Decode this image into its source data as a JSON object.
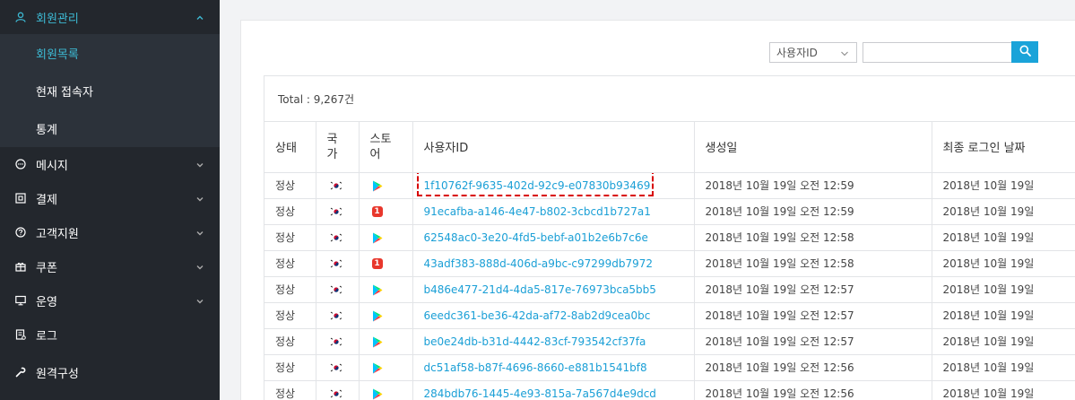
{
  "sidebar": {
    "member_menu": {
      "label": "회원관리",
      "icon": "user-icon"
    },
    "sub_items": [
      "회원목록",
      "현재 접속자",
      "통계"
    ],
    "items": [
      {
        "label": "메시지",
        "icon": "chat-icon"
      },
      {
        "label": "결제",
        "icon": "payment-icon"
      },
      {
        "label": "고객지원",
        "icon": "help-icon"
      },
      {
        "label": "쿠폰",
        "icon": "gift-icon"
      },
      {
        "label": "운영",
        "icon": "monitor-icon"
      },
      {
        "label": "로그",
        "icon": "log-icon"
      },
      {
        "label": "원격구성",
        "icon": "wrench-icon"
      }
    ],
    "accent": "#3db9d3"
  },
  "search": {
    "select_value": "사용자ID",
    "input_value": "",
    "button_icon": "search-icon"
  },
  "table": {
    "total": "Total : 9,267건",
    "headers": {
      "status": "상태",
      "country": "국가",
      "store": "스토어",
      "user_id": "사용자ID",
      "created": "생성일",
      "last_login": "최종 로그인 날짜"
    },
    "rows": [
      {
        "status": "정상",
        "country": "kr-flag-icon",
        "store": "google-play-icon",
        "user_id": "1f10762f-9635-402d-92c9-e07830b93469",
        "created": "2018년 10월 19일 오전 12:59",
        "last_login": "2018년 10월 19일"
      },
      {
        "status": "정상",
        "country": "kr-flag-icon",
        "store": "onestore-icon",
        "user_id": "91ecafba-a146-4e47-b802-3cbcd1b727a1",
        "created": "2018년 10월 19일 오전 12:59",
        "last_login": "2018년 10월 19일"
      },
      {
        "status": "정상",
        "country": "kr-flag-icon",
        "store": "google-play-icon",
        "user_id": "62548ac0-3e20-4fd5-bebf-a01b2e6b7c6e",
        "created": "2018년 10월 19일 오전 12:58",
        "last_login": "2018년 10월 19일"
      },
      {
        "status": "정상",
        "country": "kr-flag-icon",
        "store": "onestore-icon",
        "user_id": "43adf383-888d-406d-a9bc-c97299db7972",
        "created": "2018년 10월 19일 오전 12:58",
        "last_login": "2018년 10월 19일"
      },
      {
        "status": "정상",
        "country": "kr-flag-icon",
        "store": "google-play-icon",
        "user_id": "b486e477-21d4-4da5-817e-76973bca5bb5",
        "created": "2018년 10월 19일 오전 12:57",
        "last_login": "2018년 10월 19일"
      },
      {
        "status": "정상",
        "country": "kr-flag-icon",
        "store": "google-play-icon",
        "user_id": "6eedc361-be36-42da-af72-8ab2d9cea0bc",
        "created": "2018년 10월 19일 오전 12:57",
        "last_login": "2018년 10월 19일"
      },
      {
        "status": "정상",
        "country": "kr-flag-icon",
        "store": "google-play-icon",
        "user_id": "be0e24db-b31d-4442-83cf-793542cf37fa",
        "created": "2018년 10월 19일 오전 12:57",
        "last_login": "2018년 10월 19일"
      },
      {
        "status": "정상",
        "country": "kr-flag-icon",
        "store": "google-play-icon",
        "user_id": "dc51af58-b87f-4696-8660-e881b1541bf8",
        "created": "2018년 10월 19일 오전 12:56",
        "last_login": "2018년 10월 19일"
      },
      {
        "status": "정상",
        "country": "kr-flag-icon",
        "store": "google-play-icon",
        "user_id": "284bdb76-1445-4e93-815a-7a567d4e9dcd",
        "created": "2018년 10월 19일 오전 12:56",
        "last_login": "2018년 10월 19일"
      }
    ],
    "link_color": "#1a9fd6",
    "highlight_color": "#d80000"
  }
}
